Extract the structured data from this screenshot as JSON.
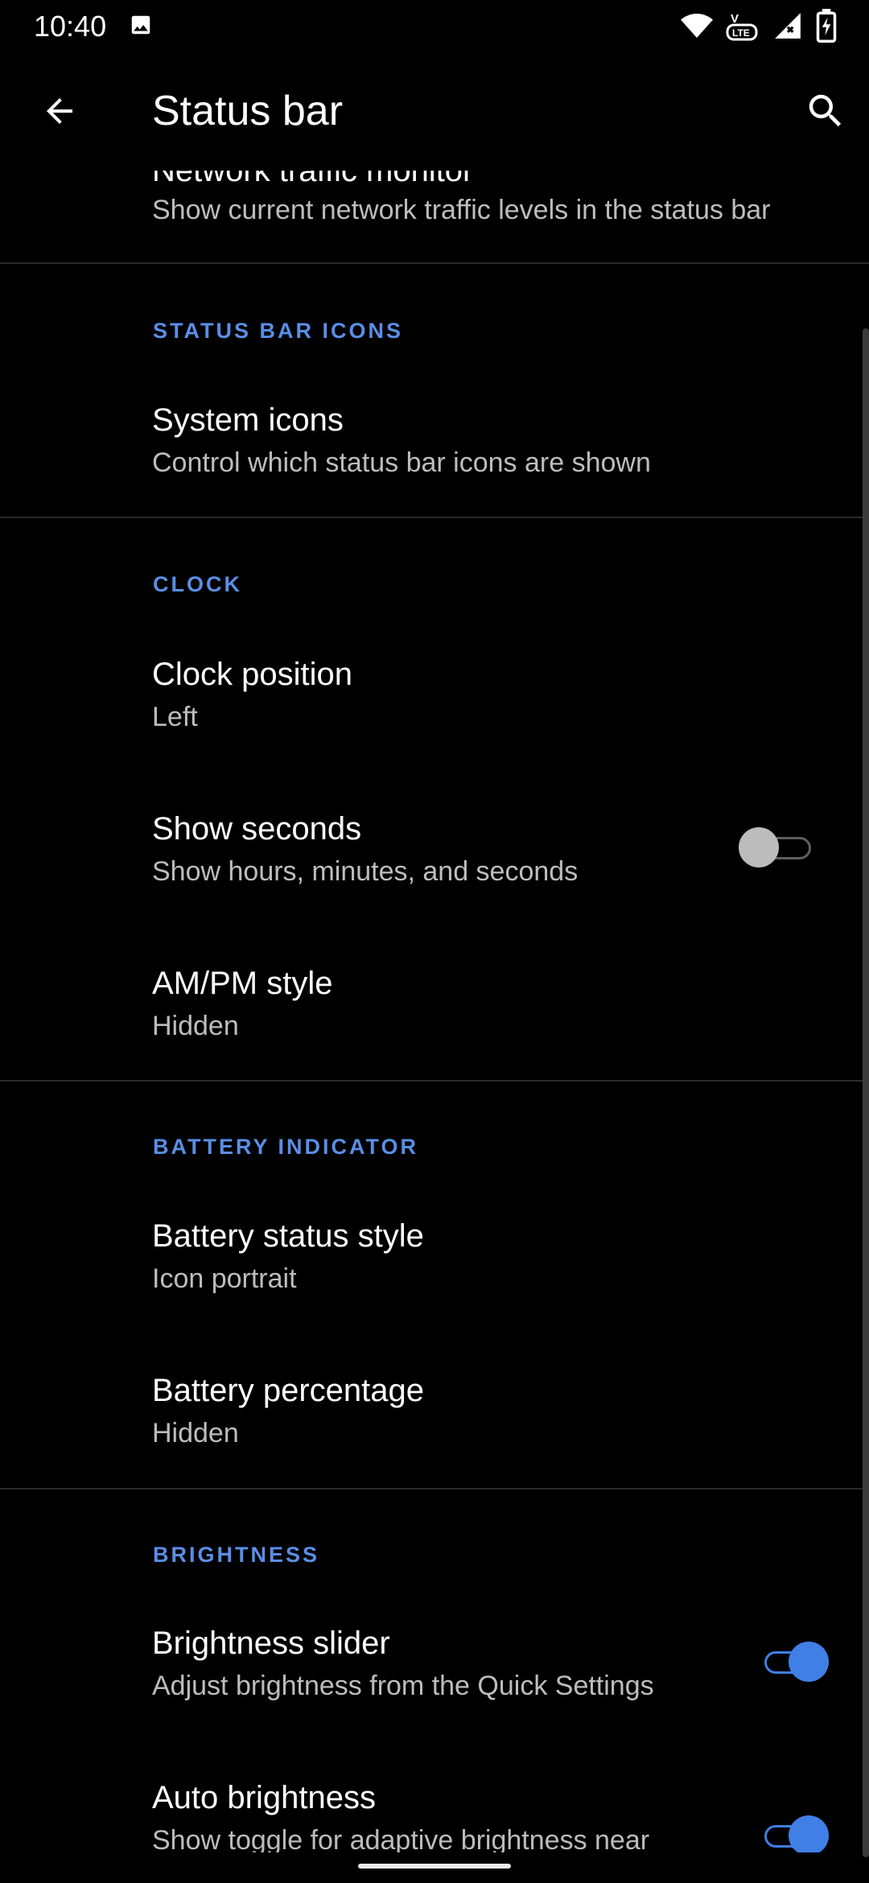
{
  "system": {
    "time": "10:40",
    "volte_label": "LTE"
  },
  "appbar": {
    "title": "Status bar"
  },
  "items": {
    "network": {
      "title": "Network traffic monitor",
      "summary": "Show current network traffic levels in the status bar"
    },
    "system_icons": {
      "title": "System icons",
      "summary": "Control which status bar icons are shown"
    },
    "clock_position": {
      "title": "Clock position",
      "summary": "Left"
    },
    "show_seconds": {
      "title": "Show seconds",
      "summary": "Show hours, minutes, and seconds",
      "enabled": false
    },
    "ampm": {
      "title": "AM/PM style",
      "summary": "Hidden"
    },
    "battery_style": {
      "title": "Battery status style",
      "summary": "Icon portrait"
    },
    "battery_pct": {
      "title": "Battery percentage",
      "summary": "Hidden"
    },
    "brightness_slider": {
      "title": "Brightness slider",
      "summary": "Adjust brightness from the Quick Settings",
      "enabled": true
    },
    "auto_brightness": {
      "title": "Auto brightness",
      "summary": "Show toggle for adaptive brightness near",
      "enabled": true
    }
  },
  "headers": {
    "status_bar_icons": "STATUS BAR ICONS",
    "clock": "CLOCK",
    "battery": "BATTERY INDICATOR",
    "brightness": "BRIGHTNESS"
  },
  "colors": {
    "accent": "#5a8ee6",
    "toggle_on": "#3f7fe6",
    "background": "#000000"
  }
}
